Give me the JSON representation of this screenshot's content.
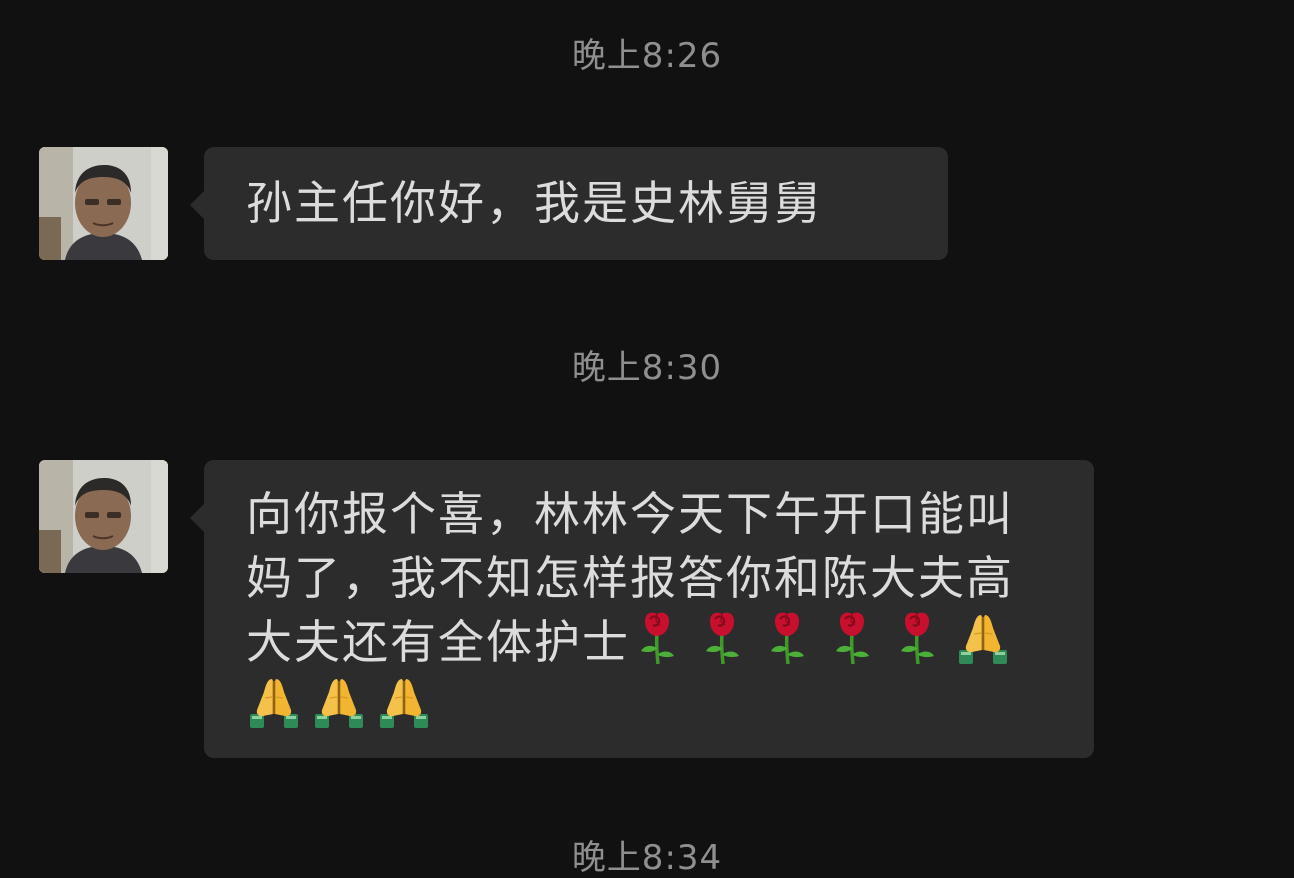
{
  "chat": {
    "timestamps": [
      "晚上8:26",
      "晚上8:30",
      "晚上8:34"
    ],
    "messages": [
      {
        "sender_avatar": "contact-avatar-photo",
        "text": "孙主任你好，我是史林舅舅",
        "emojis": []
      },
      {
        "sender_avatar": "contact-avatar-photo",
        "text": "向你报个喜，林林今天下午开口能叫妈了，我不知怎样报答你和陈大夫高大夫还有全体护士",
        "emojis": [
          "rose-icon",
          "rose-icon",
          "rose-icon",
          "rose-icon",
          "rose-icon",
          "folded-hands-icon",
          "folded-hands-icon",
          "folded-hands-icon",
          "folded-hands-icon"
        ]
      }
    ]
  },
  "colors": {
    "background": "#111111",
    "bubble": "#2c2c2c",
    "timestamp": "#8f8f8f",
    "text": "#dcdcdc"
  }
}
